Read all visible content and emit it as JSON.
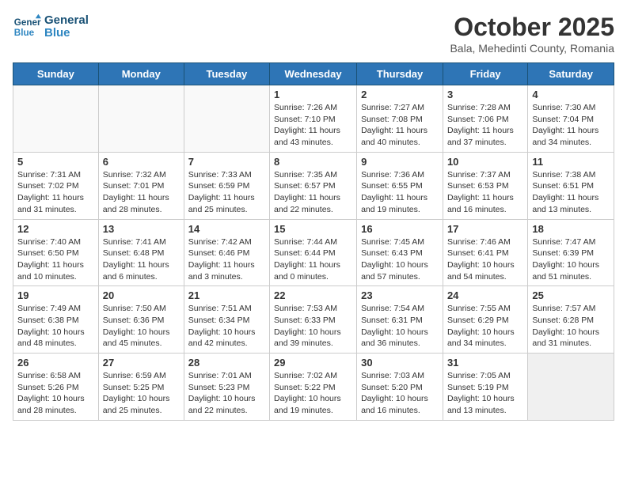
{
  "header": {
    "logo_line1": "General",
    "logo_line2": "Blue",
    "month": "October 2025",
    "location": "Bala, Mehedinti County, Romania"
  },
  "weekdays": [
    "Sunday",
    "Monday",
    "Tuesday",
    "Wednesday",
    "Thursday",
    "Friday",
    "Saturday"
  ],
  "weeks": [
    [
      {
        "day": "",
        "info": ""
      },
      {
        "day": "",
        "info": ""
      },
      {
        "day": "",
        "info": ""
      },
      {
        "day": "1",
        "info": "Sunrise: 7:26 AM\nSunset: 7:10 PM\nDaylight: 11 hours\nand 43 minutes."
      },
      {
        "day": "2",
        "info": "Sunrise: 7:27 AM\nSunset: 7:08 PM\nDaylight: 11 hours\nand 40 minutes."
      },
      {
        "day": "3",
        "info": "Sunrise: 7:28 AM\nSunset: 7:06 PM\nDaylight: 11 hours\nand 37 minutes."
      },
      {
        "day": "4",
        "info": "Sunrise: 7:30 AM\nSunset: 7:04 PM\nDaylight: 11 hours\nand 34 minutes."
      }
    ],
    [
      {
        "day": "5",
        "info": "Sunrise: 7:31 AM\nSunset: 7:02 PM\nDaylight: 11 hours\nand 31 minutes."
      },
      {
        "day": "6",
        "info": "Sunrise: 7:32 AM\nSunset: 7:01 PM\nDaylight: 11 hours\nand 28 minutes."
      },
      {
        "day": "7",
        "info": "Sunrise: 7:33 AM\nSunset: 6:59 PM\nDaylight: 11 hours\nand 25 minutes."
      },
      {
        "day": "8",
        "info": "Sunrise: 7:35 AM\nSunset: 6:57 PM\nDaylight: 11 hours\nand 22 minutes."
      },
      {
        "day": "9",
        "info": "Sunrise: 7:36 AM\nSunset: 6:55 PM\nDaylight: 11 hours\nand 19 minutes."
      },
      {
        "day": "10",
        "info": "Sunrise: 7:37 AM\nSunset: 6:53 PM\nDaylight: 11 hours\nand 16 minutes."
      },
      {
        "day": "11",
        "info": "Sunrise: 7:38 AM\nSunset: 6:51 PM\nDaylight: 11 hours\nand 13 minutes."
      }
    ],
    [
      {
        "day": "12",
        "info": "Sunrise: 7:40 AM\nSunset: 6:50 PM\nDaylight: 11 hours\nand 10 minutes."
      },
      {
        "day": "13",
        "info": "Sunrise: 7:41 AM\nSunset: 6:48 PM\nDaylight: 11 hours\nand 6 minutes."
      },
      {
        "day": "14",
        "info": "Sunrise: 7:42 AM\nSunset: 6:46 PM\nDaylight: 11 hours\nand 3 minutes."
      },
      {
        "day": "15",
        "info": "Sunrise: 7:44 AM\nSunset: 6:44 PM\nDaylight: 11 hours\nand 0 minutes."
      },
      {
        "day": "16",
        "info": "Sunrise: 7:45 AM\nSunset: 6:43 PM\nDaylight: 10 hours\nand 57 minutes."
      },
      {
        "day": "17",
        "info": "Sunrise: 7:46 AM\nSunset: 6:41 PM\nDaylight: 10 hours\nand 54 minutes."
      },
      {
        "day": "18",
        "info": "Sunrise: 7:47 AM\nSunset: 6:39 PM\nDaylight: 10 hours\nand 51 minutes."
      }
    ],
    [
      {
        "day": "19",
        "info": "Sunrise: 7:49 AM\nSunset: 6:38 PM\nDaylight: 10 hours\nand 48 minutes."
      },
      {
        "day": "20",
        "info": "Sunrise: 7:50 AM\nSunset: 6:36 PM\nDaylight: 10 hours\nand 45 minutes."
      },
      {
        "day": "21",
        "info": "Sunrise: 7:51 AM\nSunset: 6:34 PM\nDaylight: 10 hours\nand 42 minutes."
      },
      {
        "day": "22",
        "info": "Sunrise: 7:53 AM\nSunset: 6:33 PM\nDaylight: 10 hours\nand 39 minutes."
      },
      {
        "day": "23",
        "info": "Sunrise: 7:54 AM\nSunset: 6:31 PM\nDaylight: 10 hours\nand 36 minutes."
      },
      {
        "day": "24",
        "info": "Sunrise: 7:55 AM\nSunset: 6:29 PM\nDaylight: 10 hours\nand 34 minutes."
      },
      {
        "day": "25",
        "info": "Sunrise: 7:57 AM\nSunset: 6:28 PM\nDaylight: 10 hours\nand 31 minutes."
      }
    ],
    [
      {
        "day": "26",
        "info": "Sunrise: 6:58 AM\nSunset: 5:26 PM\nDaylight: 10 hours\nand 28 minutes."
      },
      {
        "day": "27",
        "info": "Sunrise: 6:59 AM\nSunset: 5:25 PM\nDaylight: 10 hours\nand 25 minutes."
      },
      {
        "day": "28",
        "info": "Sunrise: 7:01 AM\nSunset: 5:23 PM\nDaylight: 10 hours\nand 22 minutes."
      },
      {
        "day": "29",
        "info": "Sunrise: 7:02 AM\nSunset: 5:22 PM\nDaylight: 10 hours\nand 19 minutes."
      },
      {
        "day": "30",
        "info": "Sunrise: 7:03 AM\nSunset: 5:20 PM\nDaylight: 10 hours\nand 16 minutes."
      },
      {
        "day": "31",
        "info": "Sunrise: 7:05 AM\nSunset: 5:19 PM\nDaylight: 10 hours\nand 13 minutes."
      },
      {
        "day": "",
        "info": ""
      }
    ]
  ]
}
